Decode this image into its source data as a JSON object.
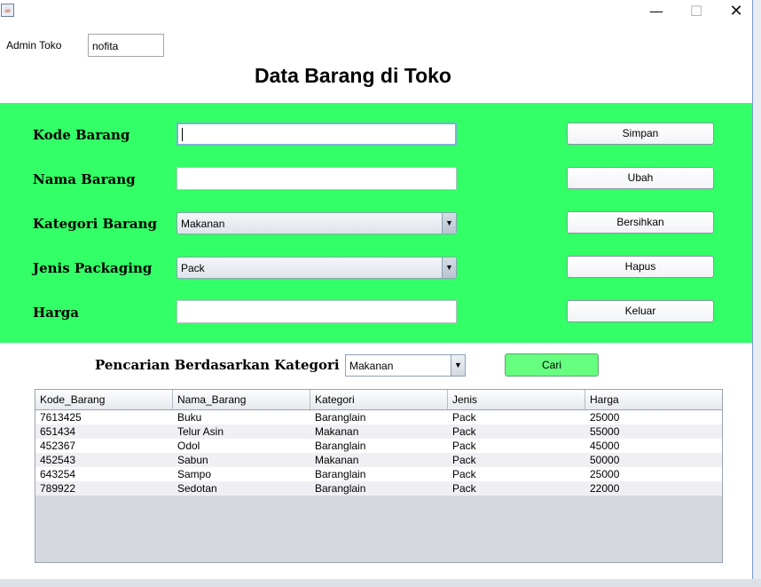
{
  "window": {
    "close_glyph": "✕",
    "min_glyph": "—",
    "max_glyph": "☐",
    "app_icon": "java-cup-icon"
  },
  "header": {
    "admin_label": "Admin Toko",
    "admin_value": "nofita",
    "title": "Data Barang di Toko"
  },
  "form": {
    "kode_label": "Kode Barang",
    "nama_label": "Nama Barang",
    "kategori_label": "Kategori Barang",
    "kategori_value": "Makanan",
    "jenis_label": "Jenis Packaging",
    "jenis_value": "Pack",
    "harga_label": "Harga"
  },
  "buttons": {
    "simpan": "Simpan",
    "ubah": "Ubah",
    "bersihkan": "Bersihkan",
    "hapus": "Hapus",
    "keluar": "Keluar"
  },
  "search": {
    "label": "Pencarian Berdasarkan Kategori",
    "value": "Makanan",
    "button": "Cari"
  },
  "table": {
    "columns": [
      "Kode_Barang",
      "Nama_Barang",
      "Kategori",
      "Jenis",
      "Harga"
    ],
    "rows": [
      [
        "7613425",
        "Buku",
        "Baranglain",
        "Pack",
        "25000"
      ],
      [
        "651434",
        "Telur Asin",
        "Makanan",
        "Pack",
        "55000"
      ],
      [
        "452367",
        "Odol",
        "Baranglain",
        "Pack",
        "45000"
      ],
      [
        "452543",
        "Sabun",
        "Makanan",
        "Pack",
        "50000"
      ],
      [
        "643254",
        "Sampo",
        "Baranglain",
        "Pack",
        "25000"
      ],
      [
        "789922",
        "Sedotan",
        "Baranglain",
        "Pack",
        "22000"
      ]
    ]
  },
  "colors": {
    "panel": "#33ff66",
    "cari_button": "#66ff80"
  }
}
